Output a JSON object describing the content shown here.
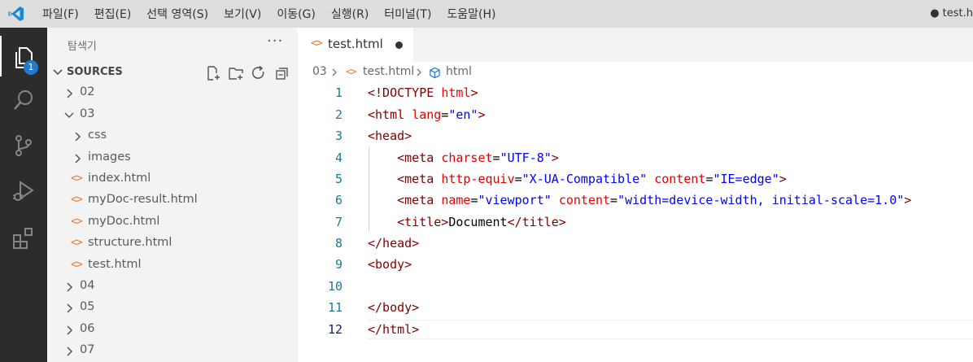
{
  "titlebar": {
    "menu": [
      "파일(F)",
      "편집(E)",
      "선택 영역(S)",
      "보기(V)",
      "이동(G)",
      "실행(R)",
      "터미널(T)",
      "도움말(H)"
    ],
    "window_title": "● test.h"
  },
  "activity": {
    "badge": "1"
  },
  "sidebar": {
    "title": "탐색기",
    "more": "···",
    "section": "SOURCES",
    "tree": [
      {
        "label": "02",
        "type": "folder",
        "expanded": false
      },
      {
        "label": "03",
        "type": "folder",
        "expanded": true
      },
      {
        "label": "css",
        "type": "folder",
        "expanded": false
      },
      {
        "label": "images",
        "type": "folder",
        "expanded": false
      },
      {
        "label": "index.html",
        "type": "file"
      },
      {
        "label": "myDoc-result.html",
        "type": "file"
      },
      {
        "label": "myDoc.html",
        "type": "file"
      },
      {
        "label": "structure.html",
        "type": "file"
      },
      {
        "label": "test.html",
        "type": "file"
      },
      {
        "label": "04",
        "type": "folder",
        "expanded": false
      },
      {
        "label": "05",
        "type": "folder",
        "expanded": false
      },
      {
        "label": "06",
        "type": "folder",
        "expanded": false
      },
      {
        "label": "07",
        "type": "folder",
        "expanded": false
      }
    ]
  },
  "editor": {
    "tab_label": "test.html",
    "file_icon": "<>",
    "breadcrumb": [
      "03",
      "test.html",
      "html"
    ],
    "line_numbers": [
      "1",
      "2",
      "3",
      "4",
      "5",
      "6",
      "7",
      "8",
      "9",
      "10",
      "11",
      "12"
    ],
    "active_line": "12"
  },
  "colors": {
    "accent": "#1f7ad1",
    "html_icon": "#e37933",
    "tag": "#800000",
    "attribute": "#e50000",
    "string": "#0000ff"
  }
}
